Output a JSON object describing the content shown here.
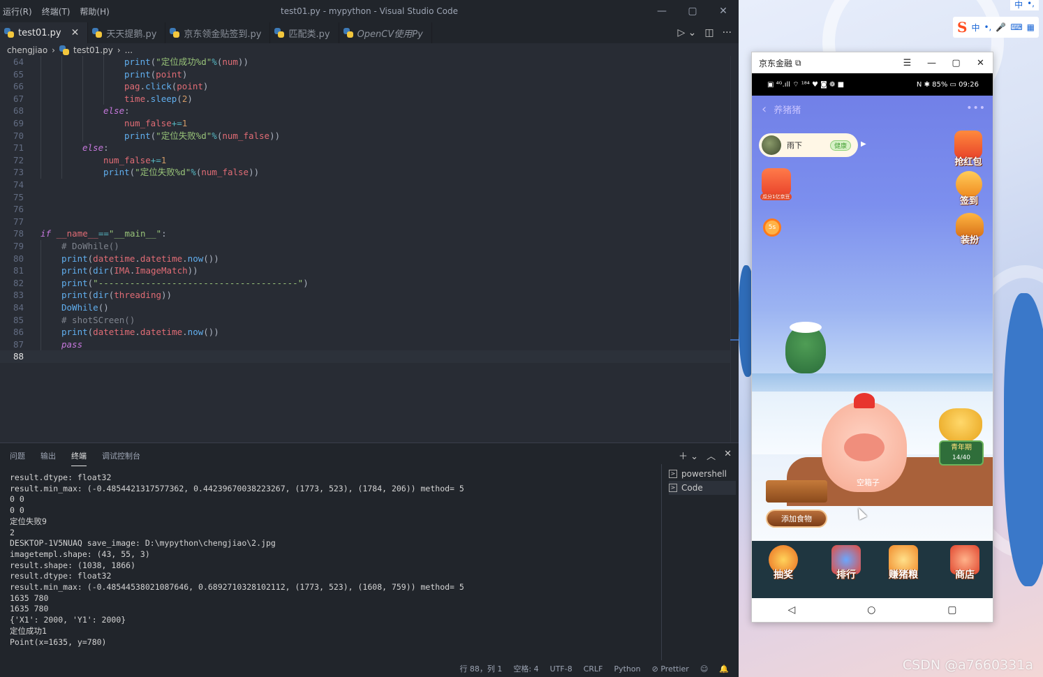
{
  "vscode": {
    "menu": [
      "运行(R)",
      "终端(T)",
      "帮助(H)"
    ],
    "window_title": "test01.py - mypython - Visual Studio Code",
    "tabs": [
      {
        "label": "test01.py",
        "active": true
      },
      {
        "label": "天天提鹅.py",
        "active": false
      },
      {
        "label": "京东领金贴签到.py",
        "active": false
      },
      {
        "label": "匹配类.py",
        "active": false
      },
      {
        "label": "OpenCV使用Py",
        "active": false
      }
    ],
    "breadcrumb": {
      "folder": "chengjiao",
      "file": "test01.py",
      "more": "..."
    },
    "code_lines": [
      {
        "n": "64",
        "indent": 16,
        "html": "<span class='fn'>print</span>(<span class='str'>\"定位成功%d\"</span><span class='op'>%</span>(<span class='var'>num</span>))"
      },
      {
        "n": "65",
        "indent": 16,
        "html": "<span class='fn'>print</span>(<span class='var'>point</span>)"
      },
      {
        "n": "66",
        "indent": 16,
        "html": "<span class='var'>pag</span>.<span class='fn'>click</span>(<span class='var'>point</span>)"
      },
      {
        "n": "67",
        "indent": 16,
        "html": "<span class='var'>time</span>.<span class='fn'>sleep</span>(<span class='numv'>2</span>)"
      },
      {
        "n": "68",
        "indent": 12,
        "html": "<span class='kw'>else</span>:"
      },
      {
        "n": "69",
        "indent": 16,
        "html": "<span class='var'>num_false</span><span class='op'>+=</span><span class='numv'>1</span>"
      },
      {
        "n": "70",
        "indent": 16,
        "html": "<span class='fn'>print</span>(<span class='str'>\"定位失败%d\"</span><span class='op'>%</span>(<span class='var'>num_false</span>))"
      },
      {
        "n": "71",
        "indent": 8,
        "html": "<span class='kw'>else</span>:"
      },
      {
        "n": "72",
        "indent": 12,
        "html": "<span class='var'>num_false</span><span class='op'>+=</span><span class='numv'>1</span>"
      },
      {
        "n": "73",
        "indent": 12,
        "html": "<span class='fn'>print</span>(<span class='str'>\"定位失败%d\"</span><span class='op'>%</span>(<span class='var'>num_false</span>))"
      },
      {
        "n": "74",
        "indent": 0,
        "html": ""
      },
      {
        "n": "75",
        "indent": 0,
        "html": ""
      },
      {
        "n": "76",
        "indent": 0,
        "html": ""
      },
      {
        "n": "77",
        "indent": 0,
        "html": ""
      },
      {
        "n": "78",
        "indent": 0,
        "html": "<span class='kw'>if</span> <span class='var'>__name__</span><span class='op'>==</span><span class='str'>\"__main__\"</span>:"
      },
      {
        "n": "79",
        "indent": 4,
        "html": "<span class='cmt'># DoWhile()</span>"
      },
      {
        "n": "80",
        "indent": 4,
        "html": "<span class='fn'>print</span>(<span class='var'>datetime</span>.<span class='var'>datetime</span>.<span class='fn'>now</span>())"
      },
      {
        "n": "81",
        "indent": 4,
        "html": "<span class='fn'>print</span>(<span class='fn'>dir</span>(<span class='var'>IMA</span>.<span class='var'>ImageMatch</span>))"
      },
      {
        "n": "82",
        "indent": 4,
        "html": "<span class='fn'>print</span>(<span class='str'>\"--------------------------------------\"</span>)"
      },
      {
        "n": "83",
        "indent": 4,
        "html": "<span class='fn'>print</span>(<span class='fn'>dir</span>(<span class='var'>threading</span>))"
      },
      {
        "n": "84",
        "indent": 4,
        "html": "<span class='fn'>DoWhile</span>()"
      },
      {
        "n": "85",
        "indent": 4,
        "html": "<span class='cmt'># shotSCreen()</span>"
      },
      {
        "n": "86",
        "indent": 4,
        "html": "<span class='fn'>print</span>(<span class='var'>datetime</span>.<span class='var'>datetime</span>.<span class='fn'>now</span>())"
      },
      {
        "n": "87",
        "indent": 4,
        "html": "<span class='kw'>pass</span>"
      },
      {
        "n": "88",
        "indent": 0,
        "html": "",
        "current": true
      }
    ],
    "panel_tabs": [
      "问题",
      "输出",
      "终端",
      "调试控制台"
    ],
    "panel_active": "终端",
    "terminal_lines": [
      "result.dtype: float32",
      "result.min_max: (-0.4854421317577362, 0.44239670038223267, (1773, 523), (1784, 206)) method= 5",
      "0 0",
      "0 0",
      "定位失败9",
      "2",
      "DESKTOP-1V5NUAQ save_image: D:\\mypython\\chengjiao\\2.jpg",
      "imagetempl.shape: (43, 55, 3)",
      "result.shape: (1038, 1866)",
      "result.dtype: float32",
      "result.min_max: (-0.48544538021087646, 0.6892710328102112, (1773, 523), (1608, 759)) method= 5",
      "1635 780",
      "1635 780",
      "{'X1': 2000, 'Y1': 2000}",
      "定位成功1",
      "Point(x=1635, y=780)"
    ],
    "terminal_list": [
      "powershell",
      "Code"
    ],
    "status": [
      "行 88，列 1",
      "空格: 4",
      "UTF-8",
      "CRLF",
      "Python",
      "⊘ Prettier"
    ]
  },
  "phone_window": {
    "title": "京东金融",
    "status_left": "▣ ⁴ᴳ.ıll ⌔ ¹⁸⁴ ♥ ◙ ❁ ■",
    "status_right": "N ✱ 85% ▭ 09:26",
    "header": "养猪猪",
    "user_name": "雨下",
    "user_badge": "健康",
    "side_left": [
      "瓜分1亿京豆",
      "5s"
    ],
    "side_right": [
      "抢红包",
      "签到",
      "装扮"
    ],
    "pig_stage_label": "青年期",
    "pig_stage_progress": "14/40",
    "empty_box": "空箱子",
    "add_food": "添加食物",
    "bottom": [
      "抽奖",
      "排行",
      "赚猪粮",
      "商店"
    ]
  },
  "ime": {
    "top": [
      "中",
      "•,"
    ],
    "bar": [
      "中",
      "•,",
      "🎤",
      "⌨",
      "▦"
    ]
  },
  "watermark": "CSDN @a7660331a",
  "colors": {
    "editor_bg": "#282c34",
    "panel_bg": "#21252b",
    "accent": "#3e6bb3"
  }
}
